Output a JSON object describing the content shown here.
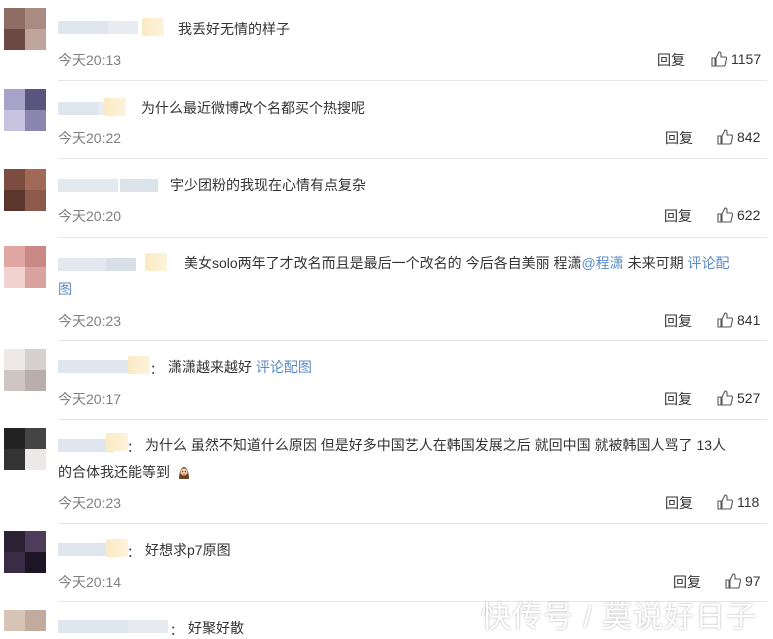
{
  "comments": [
    {
      "text": "我丢好无情的样子",
      "time": "今天20:13",
      "reply": "回复",
      "likes": "1157"
    },
    {
      "text": "为什么最近微博改个名都买个热搜呢",
      "time": "今天20:22",
      "reply": "回复",
      "likes": "842"
    },
    {
      "text": "宇少团粉的我现在心情有点复杂",
      "time": "今天20:20",
      "reply": "回复",
      "likes": "622"
    },
    {
      "text_line1": "美女solo两年了才改名而且是最后一个改名的 今后各自美丽 程潇",
      "mention": "@程潇",
      "text_line1_tail": " 未来可期 ",
      "link_part1": "评论配",
      "link_part2": "图",
      "time": "今天20:23",
      "reply": "回复",
      "likes": "841"
    },
    {
      "colon": "：",
      "text": "潇潇越来越好 ",
      "link": "评论配图",
      "time": "今天20:17",
      "reply": "回复",
      "likes": "527"
    },
    {
      "colon": "：",
      "text_line1": "为什么 虽然不知道什么原因 但是好多中国艺人在韩国发展之后 就回中国 就被韩国人骂了 13人",
      "text_line2": "的合体我还能等到",
      "time": "今天20:23",
      "reply": "回复",
      "likes": "118"
    },
    {
      "colon": "：",
      "text": "好想求p7原图",
      "time": "今天20:14",
      "reply": "回复",
      "likes": "97"
    },
    {
      "colon": "：",
      "text": "好聚好散"
    }
  ],
  "watermark": "快传号 / 莫说好日子",
  "icons": {
    "like": "thumbs-up-icon",
    "emoji": "crying-face-icon"
  },
  "colors": {
    "link": "#5a8ac6",
    "time": "#808080",
    "divider": "#e6e6e6"
  }
}
